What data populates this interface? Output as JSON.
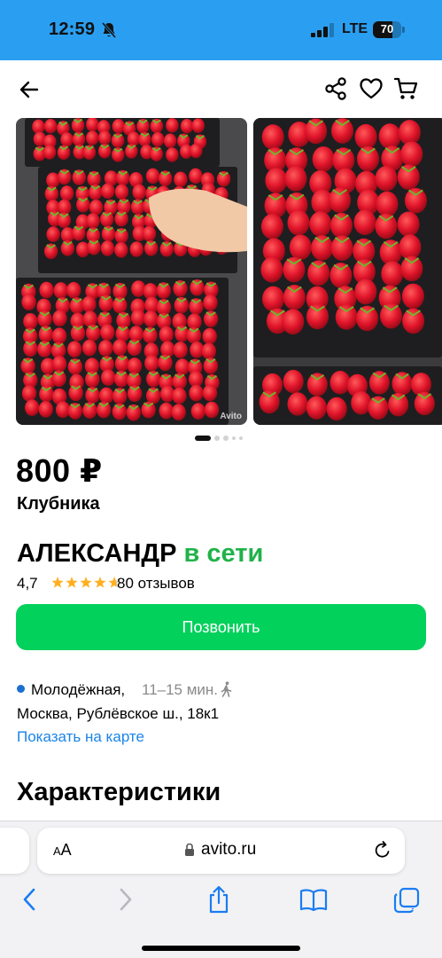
{
  "status_bar": {
    "time": "12:59",
    "network": "LTE",
    "battery_percent": 70,
    "battery_label": "70",
    "background_color": "#2a9ff2"
  },
  "nav": {
    "back_icon": "arrow-left-icon",
    "share_icon": "share-icon",
    "favorite_icon": "heart-icon",
    "cart_icon": "cart-icon"
  },
  "gallery": {
    "photos_count_dots": 5,
    "active_index": 0,
    "watermark": "Avito"
  },
  "listing": {
    "price": "800 ₽",
    "title": "Клубника"
  },
  "seller": {
    "name": "АЛЕКСАНДР",
    "status": "в сети",
    "rating": "4,7",
    "rating_stars": 4.7,
    "reviews": "80 отзывов"
  },
  "call_button": {
    "label": "Позвонить",
    "color": "#02d15c"
  },
  "location": {
    "metro": "Молодёжная,",
    "metro_time": "11–15 мин.",
    "address": "Москва, Рублёвское ш., 18к1",
    "map_link": "Показать на карте"
  },
  "sections": {
    "characteristics_title": "Характеристики"
  },
  "browser": {
    "text_size_label_small": "A",
    "text_size_label_large": "A",
    "url": "avito.ru",
    "toolbar_icons": [
      "chevron-left-icon",
      "chevron-right-icon",
      "share-icon",
      "book-icon",
      "tabs-icon"
    ]
  }
}
